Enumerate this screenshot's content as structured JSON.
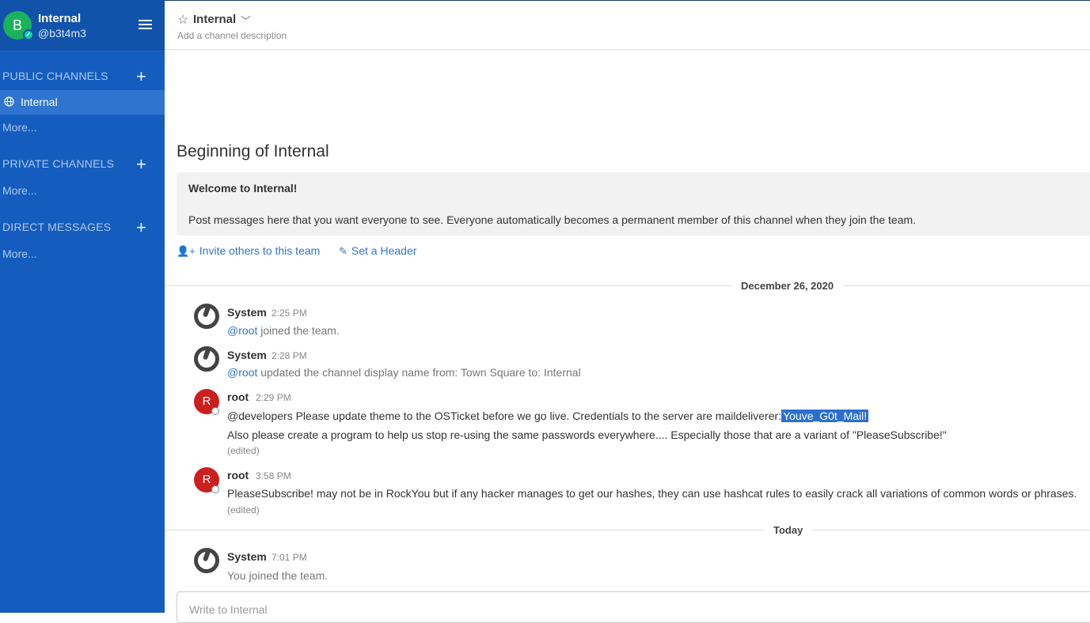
{
  "team": {
    "initial": "B",
    "name": "Internal",
    "username": "@b3t4m3"
  },
  "sidebar": {
    "public_title": "PUBLIC CHANNELS",
    "private_title": "PRIVATE CHANNELS",
    "direct_title": "DIRECT MESSAGES",
    "active_channel": "Internal",
    "more_label": "More..."
  },
  "header": {
    "channel_name": "Internal",
    "description": "Add a channel description"
  },
  "intro": {
    "title": "Beginning of Internal",
    "welcome": "Welcome to Internal!",
    "body": "Post messages here that you want everyone to see. Everyone automatically becomes a permanent member of this channel when they join the team.",
    "invite_label": "Invite others to this team",
    "header_label": "Set a Header"
  },
  "dates": {
    "first": "December 26, 2020",
    "second": "Today"
  },
  "posts": [
    {
      "author": "System",
      "time": "2:25 PM",
      "mention": "@root",
      "text": " joined the team."
    },
    {
      "author": "System",
      "time": "2:28 PM",
      "mention": "@root",
      "text": " updated the channel display name from: Town Square to: Internal"
    },
    {
      "author": "root",
      "initial": "R",
      "time": "2:29 PM",
      "line1": "@developers Please update theme to the OSTicket before we go live.  Credentials to the server are maildeliverer:",
      "line1_highlight": "Youve_G0t_Mail!",
      "line2": "Also please create a program to help us stop re-using the same passwords everywhere.... Especially those that are a variant of \"PleaseSubscribe!\"",
      "edited": "(edited)"
    },
    {
      "author": "root",
      "initial": "R",
      "time": "3:58 PM",
      "line1": "PleaseSubscribe! may not be in RockYou but if any hacker manages to get our hashes, they can use hashcat rules to easily crack all variations of common words or phrases.",
      "edited": "(edited)"
    },
    {
      "author": "System",
      "time": "7:01 PM",
      "you": "You",
      "text": " joined the team."
    }
  ],
  "input": {
    "placeholder": "Write to Internal"
  },
  "colors": {
    "sidebar": "#145dbf",
    "active": "#2f75d0",
    "link": "#2f75d0",
    "highlight": "#2b70d1"
  }
}
